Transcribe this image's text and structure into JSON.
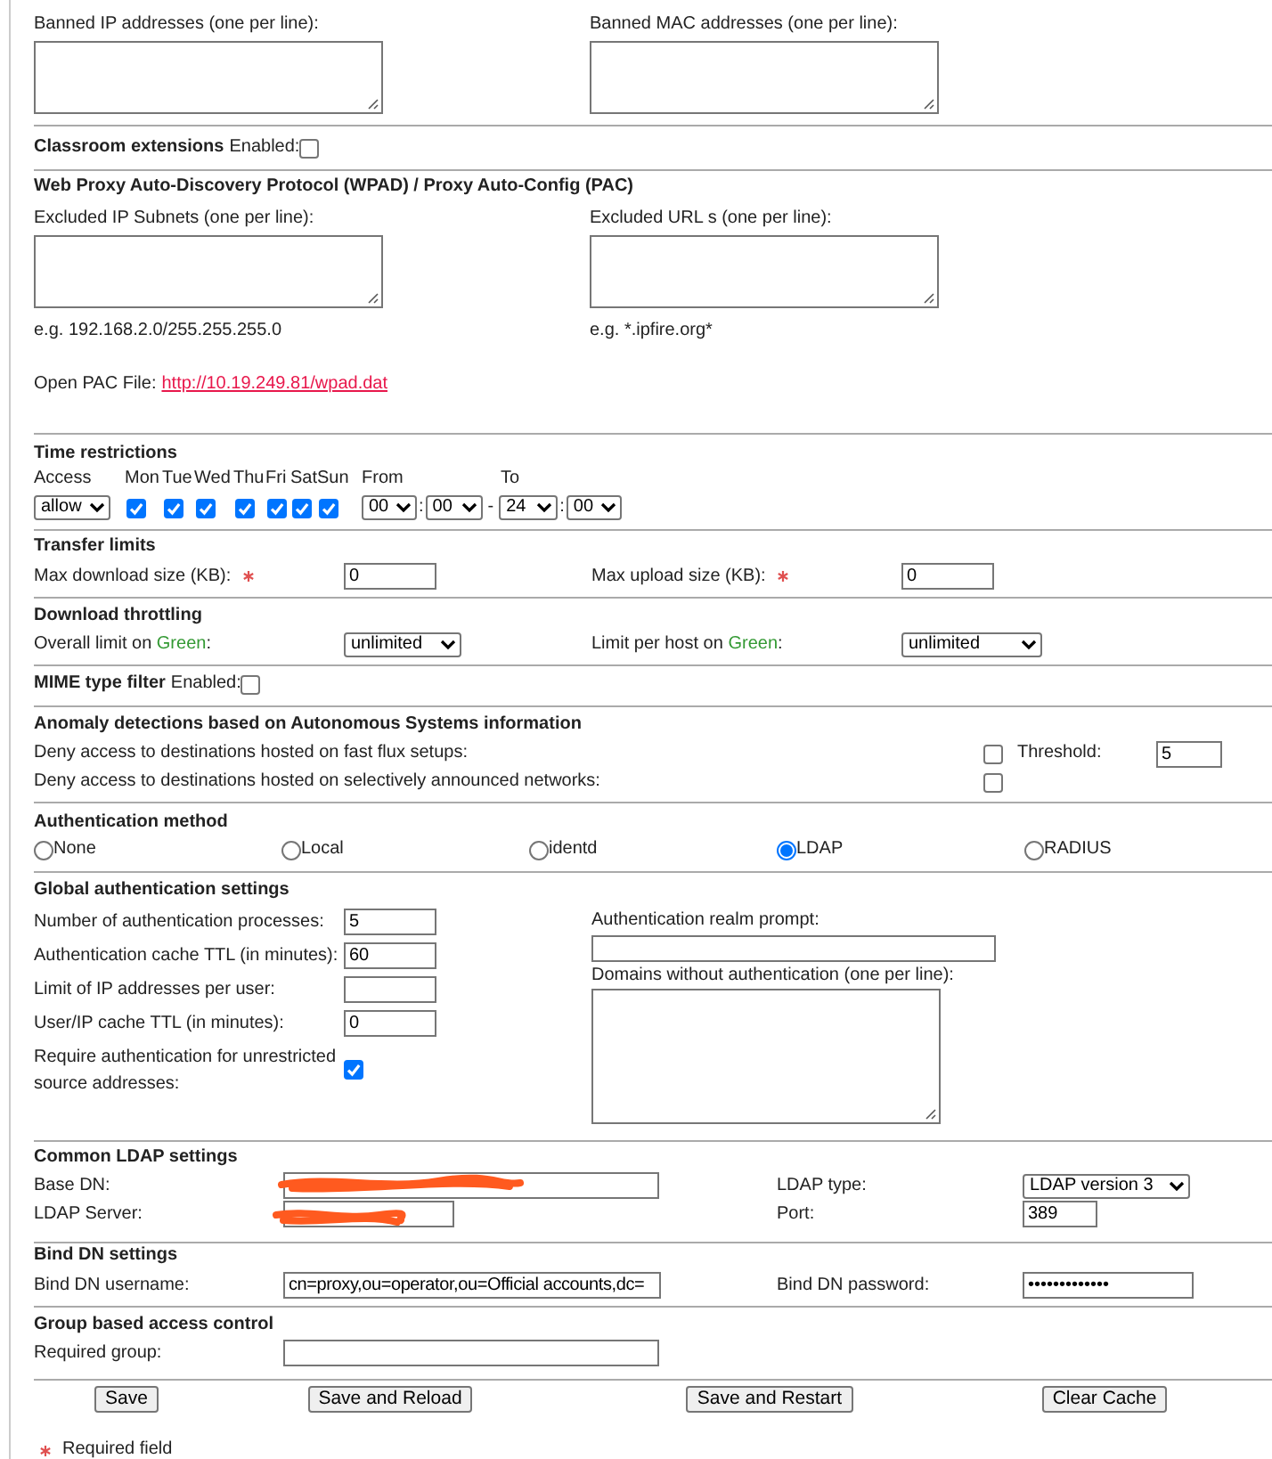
{
  "banned": {
    "ip_label": "Banned IP addresses (one per line):",
    "mac_label": "Banned MAC addresses (one per line):"
  },
  "classroom": {
    "title": "Classroom extensions",
    "enabled_label": "Enabled:",
    "enabled": false
  },
  "wpad": {
    "title": "Web Proxy Auto-Discovery Protocol (WPAD) / Proxy Auto-Config (PAC)",
    "subnets_label": "Excluded IP Subnets (one per line):",
    "subnets_hint": "e.g. 192.168.2.0/255.255.255.0",
    "urls_label": "Excluded URL s (one per line):",
    "urls_hint": "e.g. *.ipfire.org*",
    "pac_label": "Open PAC File:",
    "pac_link": "http://10.19.249.81/wpad.dat"
  },
  "time_restrictions": {
    "title": "Time restrictions",
    "access_label": "Access",
    "access": "allow",
    "days": [
      {
        "label": "Mon",
        "checked": true
      },
      {
        "label": "Tue",
        "checked": true
      },
      {
        "label": "Wed",
        "checked": true
      },
      {
        "label": "Thu",
        "checked": true
      },
      {
        "label": "Fri",
        "checked": true
      },
      {
        "label": "Sat",
        "checked": true
      },
      {
        "label": "Sun",
        "checked": true
      }
    ],
    "from_label": "From",
    "to_label": "To",
    "from_hour": "00",
    "from_sep": ":",
    "from_minute": "00",
    "range_sep": "-",
    "to_hour": "24",
    "to_sep": ":",
    "to_minute": "00"
  },
  "transfer_limits": {
    "title": "Transfer limits",
    "fields": [
      {
        "label": "Max download size (KB):",
        "required": true,
        "value": "0"
      },
      {
        "label": "Max upload size (KB):",
        "required": true,
        "value": "0"
      }
    ]
  },
  "download_throttling": {
    "title": "Download throttling",
    "fields": [
      {
        "label_parts": [
          "Overall limit on ",
          "Green",
          ":"
        ],
        "value": "unlimited"
      },
      {
        "label_parts": [
          "Limit per host on ",
          "Green",
          ":"
        ],
        "value": "unlimited"
      }
    ]
  },
  "mime_filter": {
    "title": "MIME type filter",
    "enabled_label": "Enabled:",
    "enabled": false
  },
  "anomaly": {
    "title": "Anomaly detections based on Autonomous Systems information",
    "fast_flux": {
      "label": "Deny access to destinations hosted on fast flux setups:",
      "checked": false,
      "threshold_label": "Threshold:",
      "threshold": "5"
    },
    "selective": {
      "label": "Deny access to destinations hosted on selectively announced networks:",
      "checked": false
    }
  },
  "auth_method": {
    "title": "Authentication method",
    "options": [
      {
        "label": "None",
        "selected": false
      },
      {
        "label": "Local",
        "selected": false
      },
      {
        "label": "identd",
        "selected": false
      },
      {
        "label": "LDAP",
        "selected": true
      },
      {
        "label": "RADIUS",
        "selected": false
      }
    ]
  },
  "global_auth": {
    "title": "Global authentication settings",
    "fields": [
      {
        "label": "Number of authentication processes:",
        "value": "5"
      },
      {
        "label": "Authentication cache TTL (in minutes):",
        "value": "60"
      },
      {
        "label": "Limit of IP addresses per user:"
      },
      {
        "label": "User/IP cache TTL (in minutes):",
        "value": "0"
      }
    ],
    "require_auth": {
      "label": "Require authentication for unrestricted source addresses:",
      "checked": true
    },
    "realm_label": "Authentication realm prompt:",
    "domains_label": "Domains without authentication (one per line):"
  },
  "ldap": {
    "title": "Common LDAP settings",
    "base_dn": {
      "label": "Base DN:",
      "redacted": true
    },
    "server": {
      "label": "LDAP Server:",
      "redacted": true
    },
    "type_label": "LDAP type:",
    "type": "LDAP version 3",
    "port_label": "Port:",
    "port": "389"
  },
  "bind_dn": {
    "title": "Bind DN settings",
    "username_label": "Bind DN username:",
    "username": "cn=proxy,ou=operator,ou=Official accounts,dc=",
    "password_label": "Bind DN password:",
    "password": "•••••••••••••"
  },
  "group_access": {
    "title": "Group based access control",
    "required_group_label": "Required group:"
  },
  "buttons": [
    "Save",
    "Save and Reload",
    "Save and Restart",
    "Clear Cache"
  ],
  "legend": {
    "required": true,
    "label": "Required field"
  }
}
